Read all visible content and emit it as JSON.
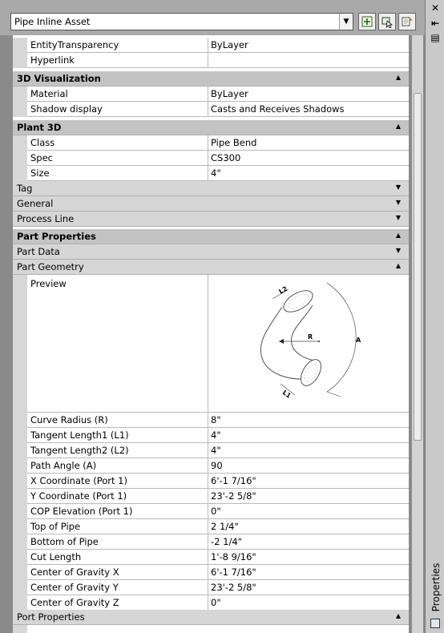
{
  "header": {
    "object_type": "Pipe Inline Asset",
    "buttons": [
      "select-objects-icon",
      "quick-select-icon",
      "toggle-pickadd-icon"
    ]
  },
  "palette": {
    "title": "Properties",
    "close_glyph": "✕",
    "autohide_glyph": "⇤",
    "menu_glyph": "▤"
  },
  "rows": {
    "entity_transparency": {
      "label": "EntityTransparency",
      "value": "ByLayer"
    },
    "hyperlink": {
      "label": "Hyperlink",
      "value": ""
    },
    "material": {
      "label": "Material",
      "value": "ByLayer"
    },
    "shadow_display": {
      "label": "Shadow display",
      "value": "Casts and Receives Shadows"
    },
    "class": {
      "label": "Class",
      "value": "Pipe Bend"
    },
    "spec": {
      "label": "Spec",
      "value": "CS300"
    },
    "size": {
      "label": "Size",
      "value": "4\""
    },
    "preview": {
      "label": "Preview"
    },
    "curve_radius": {
      "label": "Curve Radius (R)",
      "value": "8\""
    },
    "tangent_length1": {
      "label": "Tangent Length1 (L1)",
      "value": "4\""
    },
    "tangent_length2": {
      "label": "Tangent Length2 (L2)",
      "value": "4\""
    },
    "path_angle": {
      "label": "Path Angle (A)",
      "value": "90"
    },
    "x_coordinate": {
      "label": "X Coordinate (Port 1)",
      "value": "6'-1 7/16\""
    },
    "y_coordinate": {
      "label": "Y Coordinate (Port 1)",
      "value": "23'-2 5/8\""
    },
    "cop_elevation": {
      "label": "COP Elevation (Port 1)",
      "value": "0\""
    },
    "top_of_pipe": {
      "label": "Top of Pipe",
      "value": "2 1/4\""
    },
    "bottom_of_pipe": {
      "label": "Bottom of Pipe",
      "value": "-2 1/4\""
    },
    "cut_length": {
      "label": "Cut Length",
      "value": "1'-8 9/16\""
    },
    "cog_x": {
      "label": "Center of Gravity X",
      "value": "6'-1 7/16\""
    },
    "cog_y": {
      "label": "Center of Gravity Y",
      "value": "23'-2 5/8\""
    },
    "cog_z": {
      "label": "Center of Gravity Z",
      "value": "0\""
    }
  },
  "categories": {
    "viz3d": {
      "label": "3D Visualization",
      "state": "expanded"
    },
    "plant3d": {
      "label": "Plant 3D",
      "state": "expanded"
    },
    "tag": {
      "label": "Tag",
      "state": "collapsed"
    },
    "general": {
      "label": "General",
      "state": "collapsed"
    },
    "process_line": {
      "label": "Process Line",
      "state": "collapsed"
    },
    "part_properties": {
      "label": "Part Properties",
      "state": "expanded"
    },
    "part_data": {
      "label": "Part Data",
      "state": "collapsed"
    },
    "part_geometry": {
      "label": "Part Geometry",
      "state": "expanded"
    },
    "port_properties": {
      "label": "Port Properties",
      "state": "expanded"
    }
  },
  "preview_labels": {
    "l1": "L1",
    "l2": "L2",
    "r": "R",
    "a": "A"
  },
  "glyphs": {
    "expanded": "▲",
    "collapsed": "▼",
    "dropdown": "▼"
  }
}
